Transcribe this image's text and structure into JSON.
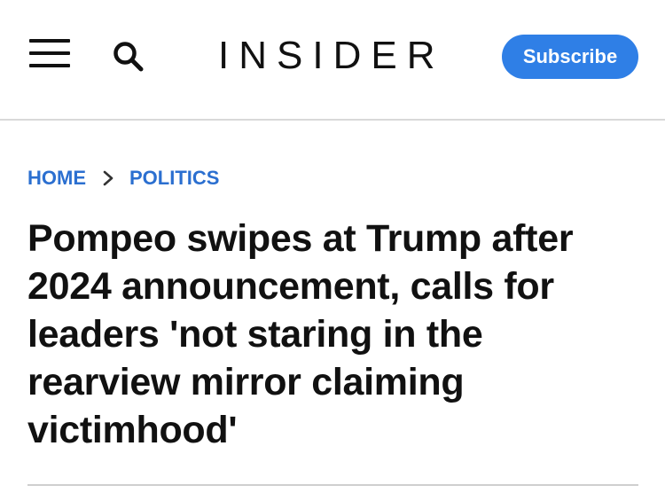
{
  "header": {
    "logo_text": "INSIDER",
    "subscribe_label": "Subscribe",
    "menu_icon": "hamburger-menu-icon",
    "search_icon": "search-icon"
  },
  "breadcrumb": {
    "items": [
      "HOME",
      "POLITICS"
    ],
    "separator_icon": "chevron-right-icon"
  },
  "article": {
    "headline": "Pompeo swipes at Trump after 2024 announcement, calls for leaders 'not staring in the rearview mirror claiming victimhood'"
  },
  "colors": {
    "accent": "#2f7fe6",
    "link": "#2b6fd0",
    "text": "#111111"
  }
}
